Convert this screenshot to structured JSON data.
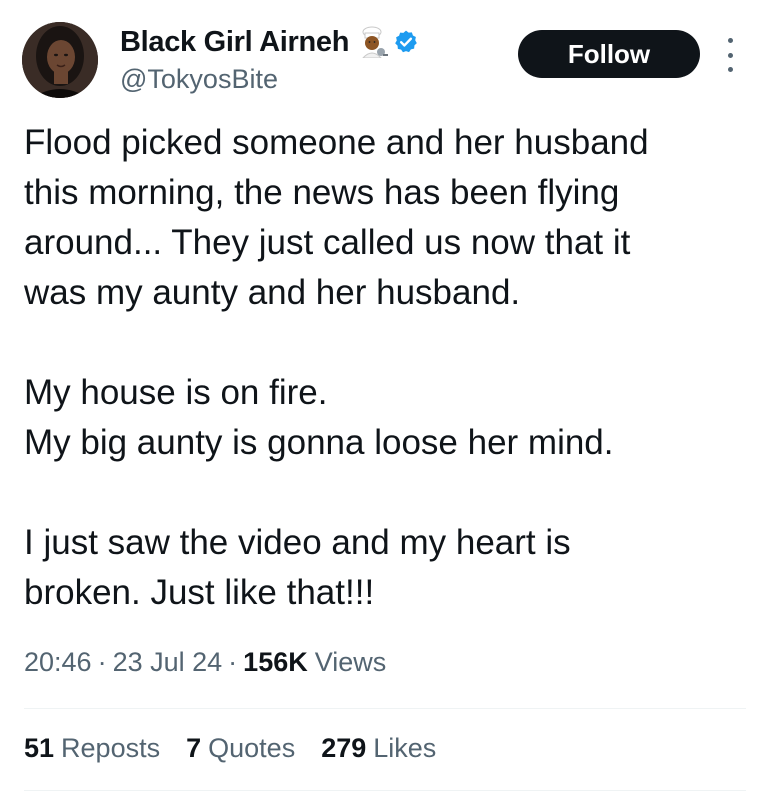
{
  "author": {
    "display_name": "Black Girl Airneh",
    "handle": "@TokyosBite",
    "badge_icon": "chef-emoji-icon",
    "verified_icon": "verified-badge-icon",
    "verified_color": "#1d9bf0"
  },
  "actions": {
    "follow_label": "Follow",
    "more_icon": "more-vertical-icon"
  },
  "tweet": {
    "paragraphs": [
      [
        "Flood picked someone and her husband",
        "this morning, the news has been flying",
        "around... They just called us now that it",
        "was my aunty and her husband."
      ],
      [
        "My house is on fire.",
        "My big aunty is gonna loose her mind."
      ],
      [
        "I just saw the video and my heart is",
        "broken. Just like that!!!"
      ]
    ]
  },
  "meta": {
    "time": "20:46",
    "separator": "·",
    "date": "23 Jul 24",
    "views_count": "156K",
    "views_label": "Views"
  },
  "stats": {
    "reposts_count": "51",
    "reposts_label": "Reposts",
    "quotes_count": "7",
    "quotes_label": "Quotes",
    "likes_count": "279",
    "likes_label": "Likes"
  },
  "colors": {
    "text_primary": "#0f1419",
    "text_secondary": "#536471",
    "button_bg": "#0f1419",
    "divider": "#eff3f4"
  }
}
